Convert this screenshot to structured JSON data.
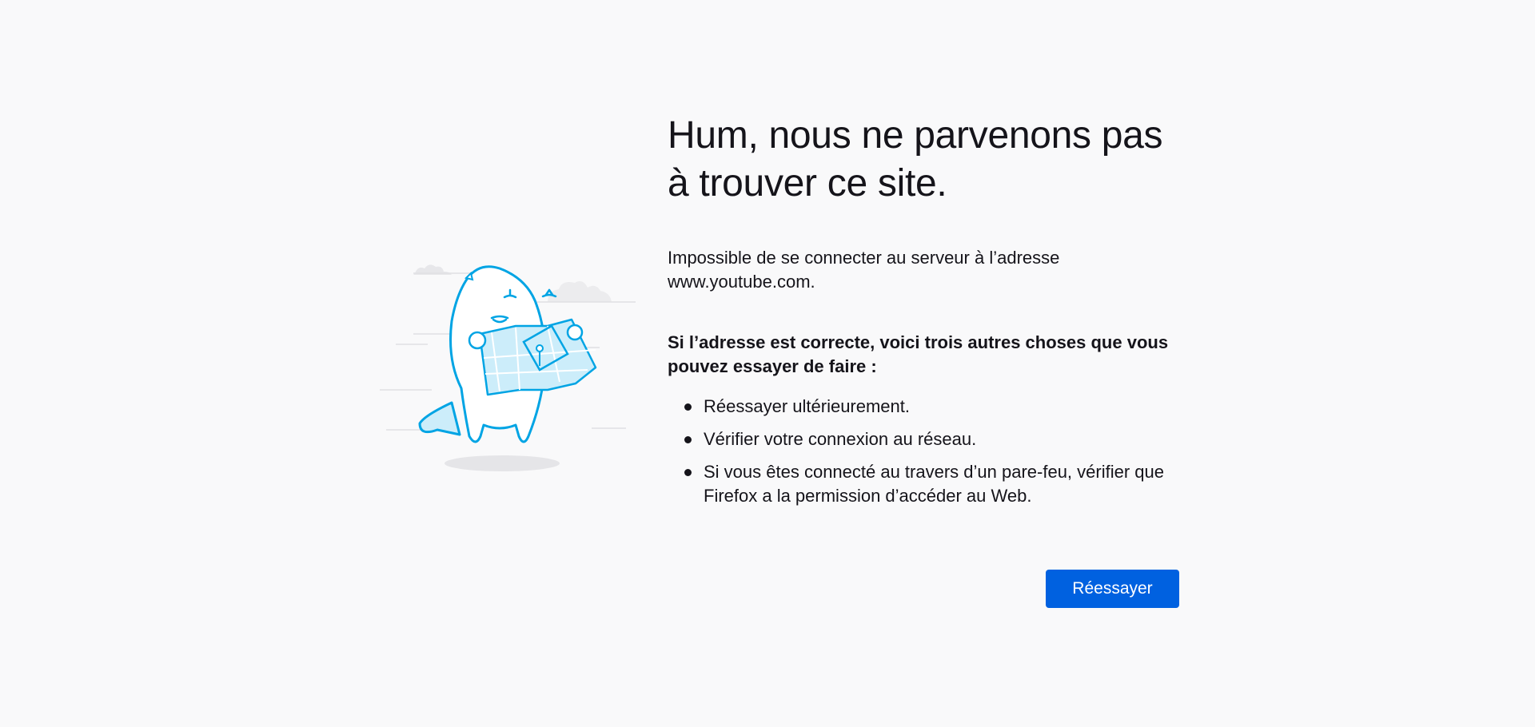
{
  "error": {
    "title": "Hum, nous ne parvenons pas à trouver ce site.",
    "description": "Impossible de se connecter au serveur à l’adresse www.youtube.com.",
    "suggestions_heading": "Si l’adresse est correcte, voici trois autres choses que vous pouvez essayer de faire :",
    "suggestions": [
      "Réessayer ultérieurement.",
      "Vérifier votre connexion au réseau.",
      "Si vous êtes connecté au travers d’un pare-feu, vérifier que Firefox a la permission d’accéder au Web."
    ],
    "retry_label": "Réessayer"
  },
  "illustration": {
    "icon": "lost-map-character-icon",
    "accent_color": "#00a4e4",
    "fill_color": "#ccedfa"
  },
  "colors": {
    "background": "#f9f9fa",
    "button": "#0061e0",
    "text": "#15141a"
  }
}
